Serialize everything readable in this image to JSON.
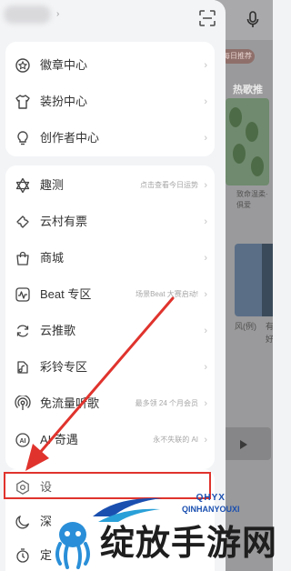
{
  "drawer": {
    "group1": [
      {
        "label": "徽章中心",
        "icon": "badge-icon"
      },
      {
        "label": "装扮中心",
        "icon": "tshirt-icon"
      },
      {
        "label": "创作者中心",
        "icon": "lightbulb-icon"
      }
    ],
    "group2": [
      {
        "label": "趣测",
        "hint": "点击查看今日运势",
        "icon": "star-of-david-icon"
      },
      {
        "label": "云村有票",
        "hint": "",
        "icon": "ticket-icon"
      },
      {
        "label": "商城",
        "hint": "",
        "icon": "shopping-bag-icon"
      },
      {
        "label": "Beat 专区",
        "hint": "场景Beat 大赛启动!",
        "icon": "waveform-icon"
      },
      {
        "label": "云推歌",
        "hint": "",
        "icon": "refresh-music-icon"
      },
      {
        "label": "彩铃专区",
        "hint": "",
        "icon": "ringtone-icon"
      },
      {
        "label": "免流量听歌",
        "hint": "最多领 24 个月会员",
        "icon": "broadcast-icon"
      },
      {
        "label": "AI 奇遇",
        "hint": "永不失联的 AI",
        "icon": "ai-icon"
      }
    ],
    "group3": [
      {
        "label": "设",
        "icon": "settings-icon"
      },
      {
        "label": "深",
        "icon": "moon-icon"
      },
      {
        "label": "定",
        "icon": "timer-icon"
      }
    ],
    "arrow_char": "›"
  },
  "background": {
    "tag": "每日推荐",
    "hot": "热歌推",
    "card1_text": "致命温柔·俱爱",
    "card2_text": "风(例)",
    "card3_text": "有 好"
  },
  "watermark": {
    "brand": "QHYX",
    "pinyin": "QINHANYOUXI",
    "text": "绽放手游网"
  },
  "colors": {
    "highlight": "#e0332d",
    "watermark_blue": "#1a4fb0"
  }
}
